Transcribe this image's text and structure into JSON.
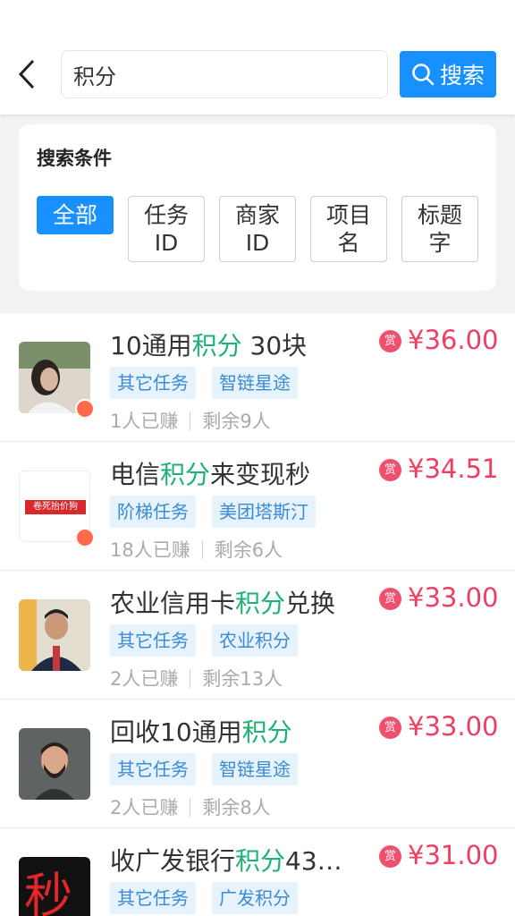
{
  "header": {
    "search_value": "积分",
    "search_button": "搜索"
  },
  "filter": {
    "title": "搜索条件",
    "chips": [
      "全部",
      "任务ID",
      "商家ID",
      "项目名",
      "标题字"
    ]
  },
  "items": [
    {
      "title_pre": "10通用",
      "title_hl": "积分",
      "title_post": " 30块",
      "tags": [
        "其它任务",
        "智链星途"
      ],
      "earned": "1人已赚",
      "remaining": "剩余9人",
      "reward_badge": "赏",
      "price": "¥36.00"
    },
    {
      "title_pre": "电信",
      "title_hl": "积分",
      "title_post": "来变现秒",
      "tags": [
        "阶梯任务",
        "美团塔斯汀"
      ],
      "earned": "18人已赚",
      "remaining": "剩余6人",
      "reward_badge": "赏",
      "price": "¥34.51",
      "avatar_text": "卷死抬价狗"
    },
    {
      "title_pre": "农业信用卡",
      "title_hl": "积分",
      "title_post": "兑换",
      "tags": [
        "其它任务",
        "农业积分"
      ],
      "earned": "2人已赚",
      "remaining": "剩余13人",
      "reward_badge": "赏",
      "price": "¥33.00"
    },
    {
      "title_pre": "回收10通用",
      "title_hl": "积分",
      "title_post": "",
      "tags": [
        "其它任务",
        "智链星途"
      ],
      "earned": "2人已赚",
      "remaining": "剩余8人",
      "reward_badge": "赏",
      "price": "¥33.00"
    },
    {
      "title_pre": "收广发银行",
      "title_hl": "积分",
      "title_post": "43…",
      "tags": [
        "其它任务",
        "广发积分"
      ],
      "earned": "",
      "remaining": "",
      "reward_badge": "赏",
      "price": "¥31.00",
      "avatar_text": "秒"
    }
  ],
  "colors": {
    "accent": "#1890ff",
    "highlight": "#1cb273",
    "price": "#ee3f63"
  }
}
